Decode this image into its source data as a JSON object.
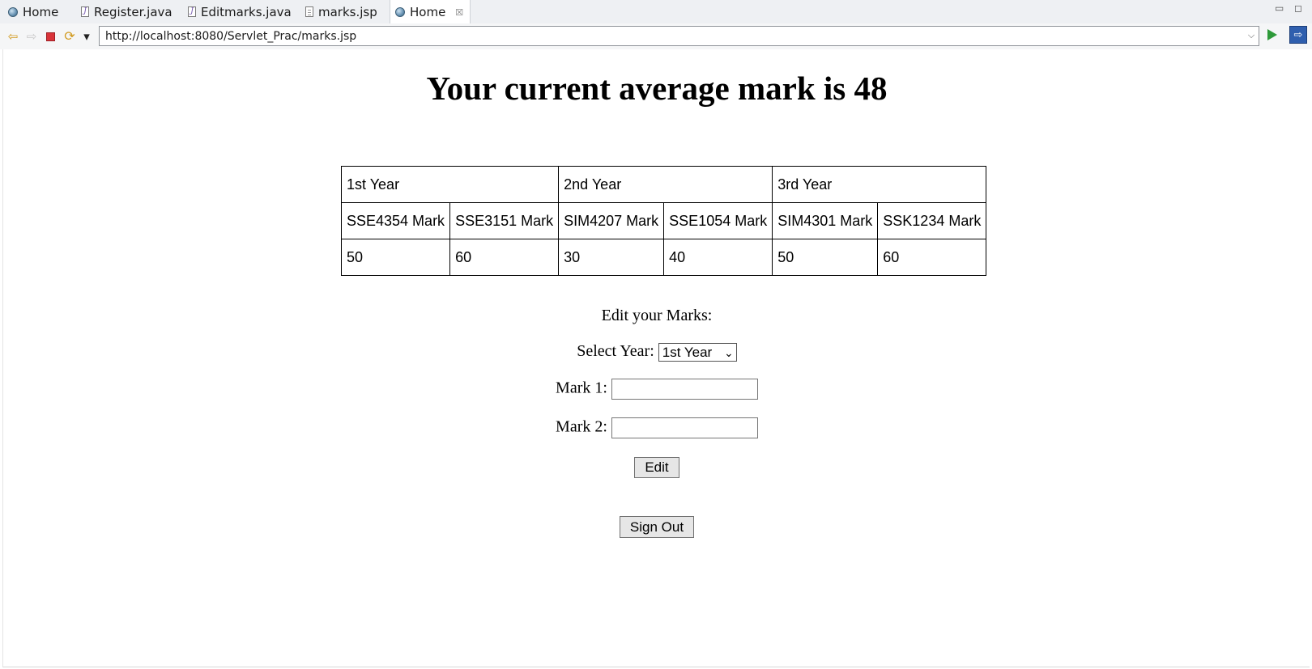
{
  "tabs": [
    {
      "label": "Home",
      "icon": "globe-icon"
    },
    {
      "label": "Register.java",
      "icon": "java-file-icon"
    },
    {
      "label": "Editmarks.java",
      "icon": "java-file-icon"
    },
    {
      "label": "marks.jsp",
      "icon": "jsp-file-icon"
    },
    {
      "label": "Home",
      "icon": "globe-icon",
      "active": true,
      "close_glyph": "☒"
    }
  ],
  "window_controls": {
    "minimize": "▭",
    "maximize": "◻"
  },
  "toolbar": {
    "back_glyph": "⇦",
    "forward_glyph": "⇨",
    "refresh_glyph": "⟳",
    "menu_glyph": "▾",
    "url": "http://localhost:8080/Servlet_Prac/marks.jsp",
    "url_dropdown_glyph": "⌵",
    "external_glyph": "⇨"
  },
  "page": {
    "heading": "Your current average mark is 48",
    "table": {
      "years": [
        "1st Year",
        "2nd Year",
        "3rd Year"
      ],
      "subjects": [
        "SSE4354 Mark",
        "SSE3151 Mark",
        "SIM4207 Mark",
        "SSE1054 Mark",
        "SIM4301 Mark",
        "SSK1234 Mark"
      ],
      "marks": [
        "50",
        "60",
        "30",
        "40",
        "50",
        "60"
      ]
    },
    "form": {
      "title": "Edit your Marks:",
      "select_year_label": "Select Year:",
      "selected_year": "1st Year",
      "select_caret": "⌄",
      "mark1_label": "Mark 1:",
      "mark1_value": "",
      "mark2_label": "Mark 2:",
      "mark2_value": "",
      "edit_button": "Edit",
      "signout_button": "Sign Out"
    }
  },
  "colors": {
    "go_button": "#2e9a3a",
    "stop_button": "#d9343a",
    "nav_arrows": "#d19a1e"
  }
}
